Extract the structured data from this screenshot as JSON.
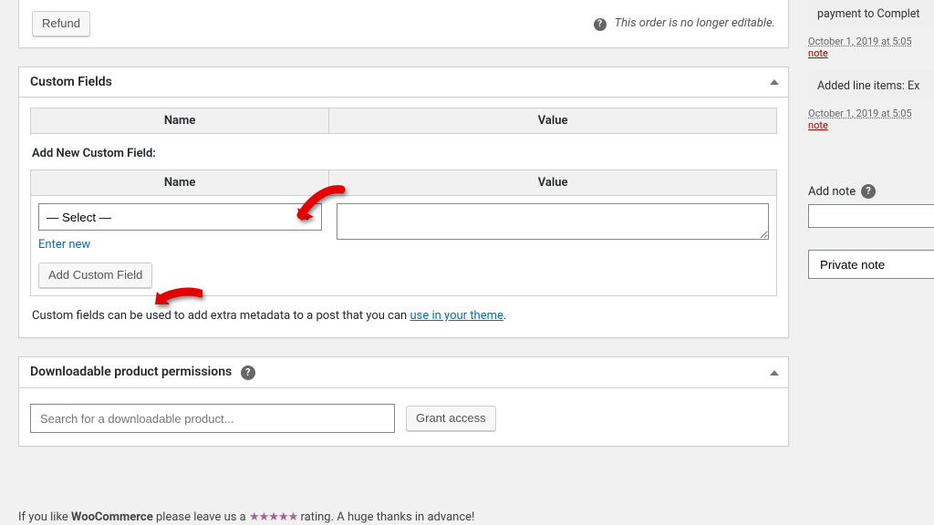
{
  "order": {
    "refund_button": "Refund",
    "not_editable": "This order is no longer editable."
  },
  "custom_fields": {
    "title": "Custom Fields",
    "table": {
      "name_header": "Name",
      "value_header": "Value"
    },
    "add_new_label": "Add New Custom Field:",
    "new_table": {
      "name_header": "Name",
      "value_header": "Value"
    },
    "select_placeholder": "— Select —",
    "enter_new": "Enter new",
    "add_button": "Add Custom Field",
    "desc_prefix": "Custom fields can be used to add extra metadata to a post that you can ",
    "desc_link": "use in your theme",
    "desc_suffix": "."
  },
  "dpp": {
    "title": "Downloadable product permissions",
    "search_placeholder": "Search for a downloadable product...",
    "grant_button": "Grant access"
  },
  "footer": {
    "prefix": "If you like ",
    "product": "WooCommerce",
    "mid": " please leave us a ",
    "stars": "★★★★★",
    "suffix": " rating. A huge thanks in advance!"
  },
  "sidebar": {
    "notes": [
      {
        "text": "payment to Complet",
        "timestamp": "October 1, 2019 at 5:05",
        "delete": "note"
      },
      {
        "text": "Added line items: Ex",
        "timestamp": "October 1, 2019 at 5:05",
        "delete": "note"
      }
    ],
    "add_note_label": "Add note",
    "note_types": {
      "selected": "Private note"
    }
  }
}
